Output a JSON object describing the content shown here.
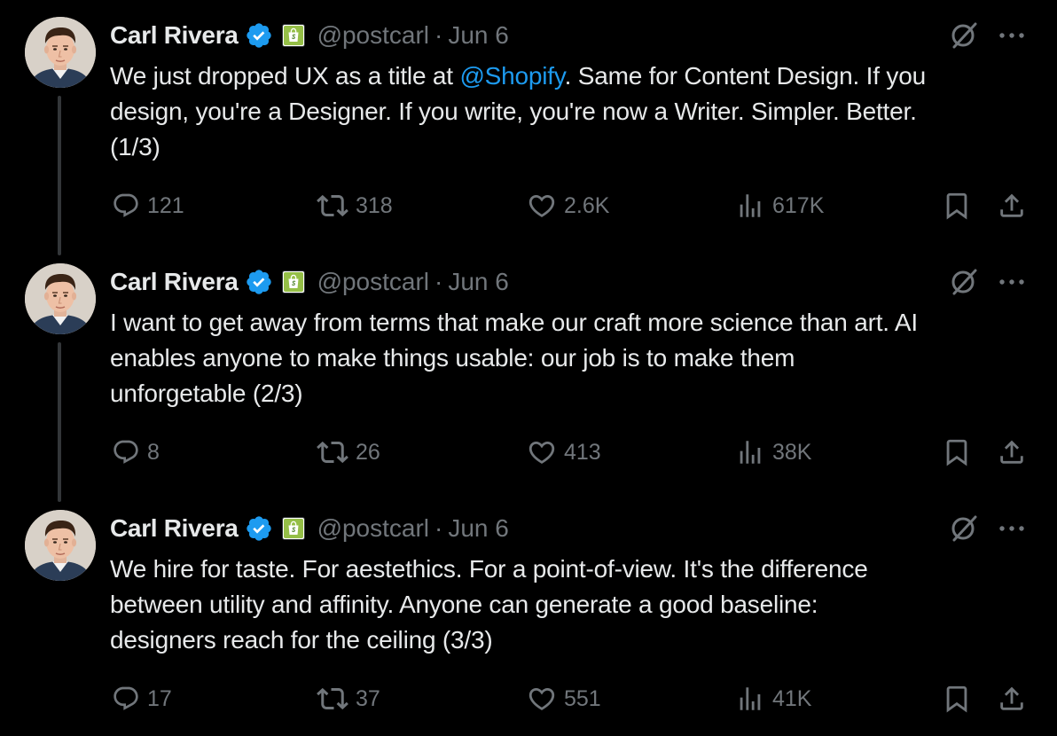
{
  "colors": {
    "background": "#000000",
    "text_primary": "#e7e9ea",
    "text_secondary": "#71767b",
    "mention": "#1d9bf0",
    "verified_badge": "#1d9bf0",
    "affiliate_badge": "#95bf47",
    "thread_line": "#333639"
  },
  "icons": {
    "verified": "verified-badge-icon",
    "affiliate": "shopify-affiliate-badge-icon",
    "grok": "grok-icon",
    "more": "more-options-icon",
    "reply": "reply-icon",
    "repost": "repost-icon",
    "like": "like-heart-icon",
    "views": "views-chart-icon",
    "bookmark": "bookmark-icon",
    "share": "share-icon"
  },
  "tweets": [
    {
      "author": {
        "name": "Carl Rivera",
        "handle": "@postcarl"
      },
      "separator": "·",
      "date": "Jun 6",
      "text": {
        "line1_before": "We just dropped UX as a title at ",
        "line1_mention": "@Shopify",
        "line1_after": ". Same for Content Design. If you",
        "line2": "design, you're a Designer. If you write, you're now a Writer. Simpler. Better.",
        "line3": "(1/3)"
      },
      "stats": {
        "replies": "121",
        "reposts": "318",
        "likes": "2.6K",
        "views": "617K"
      }
    },
    {
      "author": {
        "name": "Carl Rivera",
        "handle": "@postcarl"
      },
      "separator": "·",
      "date": "Jun 6",
      "text": {
        "line1": "I want to get away from terms that make our craft more science than art. AI",
        "line2": "enables anyone to make things usable: our job is to make them",
        "line3": "unforgetable (2/3)"
      },
      "stats": {
        "replies": "8",
        "reposts": "26",
        "likes": "413",
        "views": "38K"
      }
    },
    {
      "author": {
        "name": "Carl Rivera",
        "handle": "@postcarl"
      },
      "separator": "·",
      "date": "Jun 6",
      "text": {
        "line1": "We hire for taste. For aestethics. For a point-of-view. It's the difference",
        "line2": "between utility and affinity. Anyone can generate a good baseline:",
        "line3": "designers reach for the ceiling (3/3)"
      },
      "stats": {
        "replies": "17",
        "reposts": "37",
        "likes": "551",
        "views": "41K"
      }
    }
  ]
}
